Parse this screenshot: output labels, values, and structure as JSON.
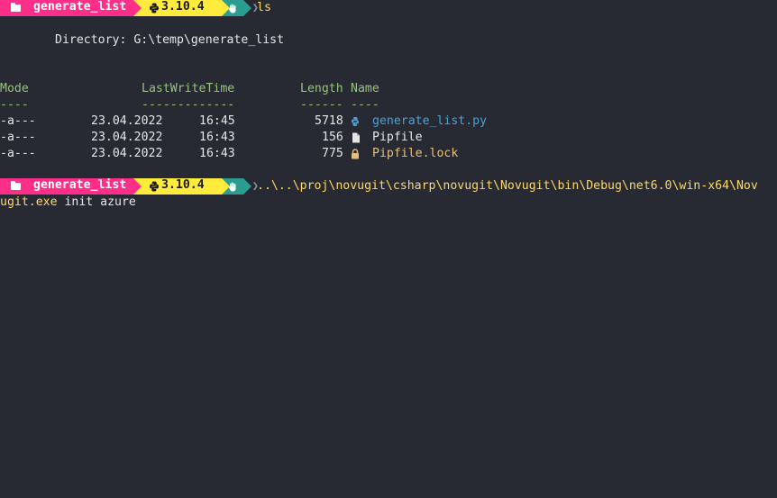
{
  "prompt1": {
    "dir_icon": "folder-icon",
    "dir": "generate_list",
    "python_icon": "python-icon",
    "python_version": "3.10.4",
    "git_icon": "hand-icon",
    "command": "ls"
  },
  "listing": {
    "directory_line": "Directory: G:\\temp\\generate_list",
    "headers": {
      "mode": "Mode",
      "lwt": "LastWriteTime",
      "length": "Length",
      "name": "Name"
    },
    "underlines": {
      "mode": "----",
      "lwt": "-------------",
      "length": "------",
      "name": "----"
    },
    "rows": [
      {
        "mode": "-a---",
        "date": "23.04.2022",
        "time": "16:45",
        "length": "5718",
        "icon": "python-file-icon",
        "name": "generate_list.py",
        "color": "#4ea1d3"
      },
      {
        "mode": "-a---",
        "date": "23.04.2022",
        "time": "16:43",
        "length": "156",
        "icon": "file-icon",
        "name": "Pipfile",
        "color": "#e6e6e6"
      },
      {
        "mode": "-a---",
        "date": "23.04.2022",
        "time": "16:43",
        "length": "775",
        "icon": "lock-icon",
        "name": "Pipfile.lock",
        "color": "#e5c07b"
      }
    ]
  },
  "prompt2": {
    "dir": "generate_list",
    "python_version": "3.10.4",
    "command_line1": "..\\..\\proj\\novugit\\csharp\\novugit\\Novugit\\bin\\Debug\\net6.0\\win-x64\\Nov",
    "command_line2_path": "ugit.exe",
    "command_line2_args": " init azure"
  },
  "colors": {
    "background": "#272a33",
    "dir_segment": "#ff2e88",
    "python_segment": "#ffeb3b",
    "git_segment": "#2a9d8f",
    "header_green": "#98c379"
  }
}
